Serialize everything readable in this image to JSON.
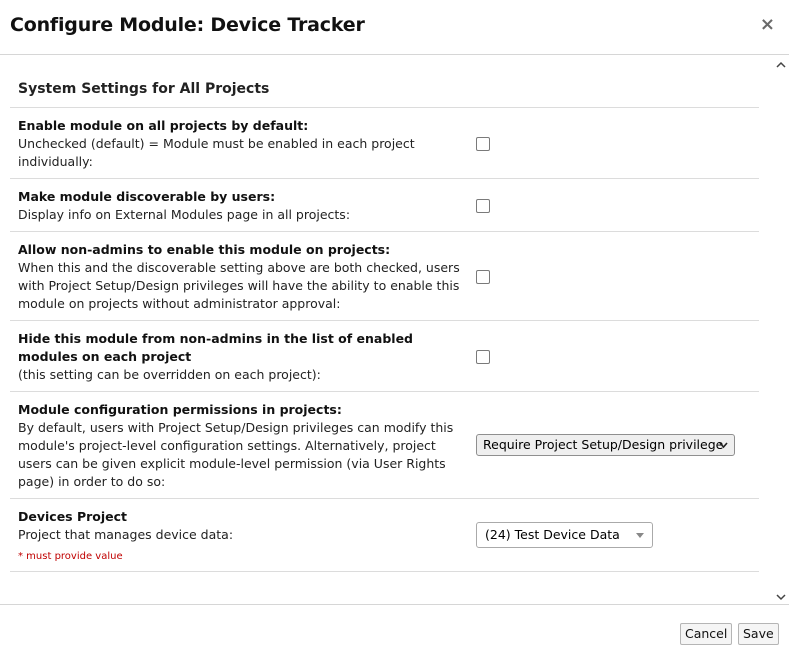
{
  "dialog": {
    "title": "Configure Module: Device Tracker",
    "close_label": "×"
  },
  "section_title": "System Settings for All Projects",
  "settings": [
    {
      "label": "Enable module on all projects by default:",
      "description": "Unchecked (default) = Module must be enabled in each project individually:",
      "checked": false
    },
    {
      "label": "Make module discoverable by users:",
      "description": "Display info on External Modules page in all projects:",
      "checked": false
    },
    {
      "label": "Allow non-admins to enable this module on projects:",
      "description": "When this and the discoverable setting above are both checked, users with Project Setup/Design privileges will have the ability to enable this module on projects without administrator approval:",
      "checked": false
    },
    {
      "label": "Hide this module from non-admins in the list of enabled modules on each project",
      "description": "(this setting can be overridden on each project):",
      "checked": false
    }
  ],
  "permissions": {
    "label": "Module configuration permissions in projects:",
    "description": "By default, users with Project Setup/Design privileges can modify this module's project-level configuration settings. Alternatively, project users can be given explicit module-level permission (via User Rights page) in order to do so:",
    "selected": "Require Project Setup/Design privilege"
  },
  "devices_project": {
    "label": "Devices Project",
    "description": "Project that manages device data:",
    "required_note": "* must provide value",
    "selected": "(24) Test Device Data"
  },
  "footer": {
    "cancel_label": "Cancel",
    "save_label": "Save"
  },
  "icons": {
    "close": "close-icon",
    "scroll_up": "scroll-up-arrow",
    "scroll_down": "scroll-down-arrow",
    "select_chevron": "chevron-down-icon",
    "dropdown_caret": "caret-down-icon"
  }
}
